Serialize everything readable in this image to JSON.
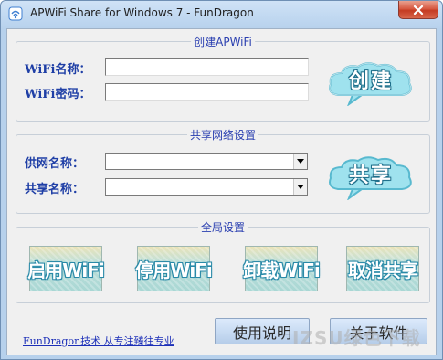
{
  "window": {
    "title": "APWiFi Share for Windows 7 - FunDragon",
    "close_icon": "close-icon"
  },
  "create_group": {
    "legend": "创建APWiFi",
    "wifi_name_label": "WiFi名称：",
    "wifi_name_value": "",
    "wifi_password_label": "WiFi密码：",
    "wifi_password_value": "",
    "create_button_label": "创建"
  },
  "share_group": {
    "legend": "共享网络设置",
    "provider_label": "供网名称：",
    "provider_value": "",
    "share_label": "共享名称：",
    "share_value": "",
    "share_button_label": "共享"
  },
  "global_group": {
    "legend": "全局设置",
    "buttons": [
      {
        "label": "启用WiFi"
      },
      {
        "label": "停用WiFi"
      },
      {
        "label": "卸载WiFi"
      },
      {
        "label": "取消共享"
      }
    ]
  },
  "footer": {
    "link_text": "FunDragon技术 从专注臻往专业",
    "help_button": "使用说明",
    "about_button": "关于软件"
  },
  "watermark": {
    "text": "IZSU绿色下载"
  },
  "colors": {
    "accent": "#1f3fa6",
    "close": "#c43b22",
    "cloud": "#7fd4e6"
  }
}
